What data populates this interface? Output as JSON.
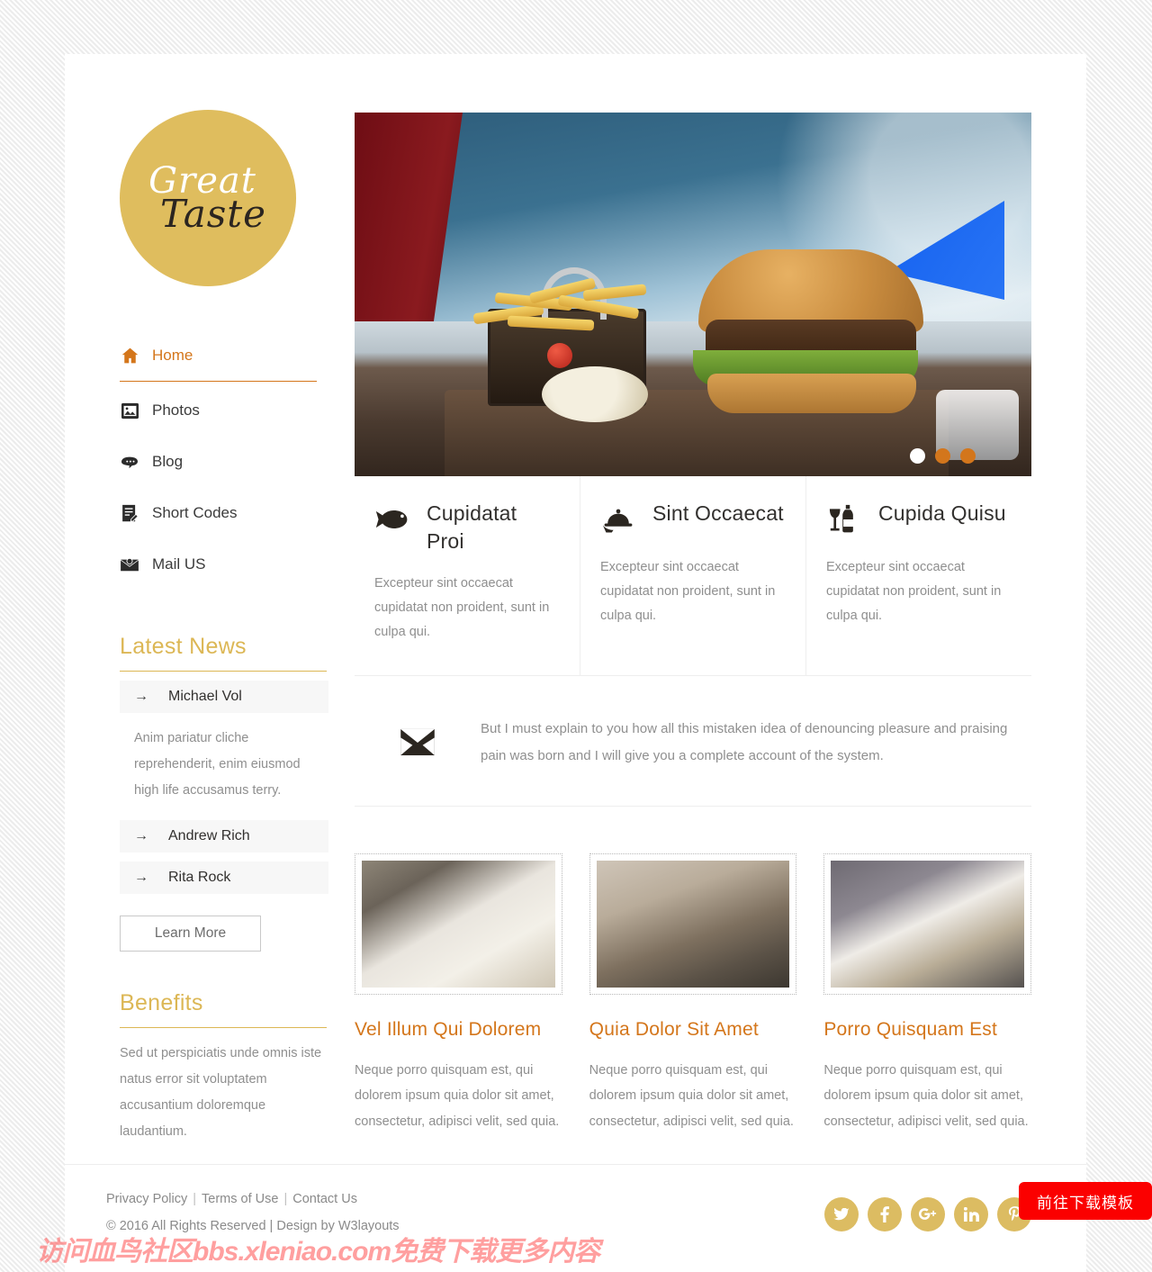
{
  "brand": {
    "line1": "Great",
    "line2": "Taste",
    "color": "#dfbd5e"
  },
  "nav": {
    "items": [
      {
        "label": "Home",
        "icon": "home-icon",
        "active": true
      },
      {
        "label": "Photos",
        "icon": "photo-icon",
        "active": false
      },
      {
        "label": "Blog",
        "icon": "blog-icon",
        "active": false
      },
      {
        "label": "Short Codes",
        "icon": "notepad-icon",
        "active": false
      },
      {
        "label": "Mail US",
        "icon": "mail-icon",
        "active": false
      }
    ],
    "active_color": "#d4761b"
  },
  "sidebar": {
    "news": {
      "heading": "Latest News",
      "items": [
        {
          "name": "Michael Vol",
          "body": "Anim pariatur cliche reprehenderit, enim eiusmod high life accusamus terry."
        },
        {
          "name": "Andrew Rich",
          "body": ""
        },
        {
          "name": "Rita Rock",
          "body": ""
        }
      ],
      "button": "Learn More"
    },
    "benefits": {
      "heading": "Benefits",
      "body": "Sed ut perspiciatis unde omnis iste natus error sit voluptatem accusantium doloremque laudantium."
    }
  },
  "hero": {
    "alt": "Burger with fries in a basket on a wooden board",
    "dots": [
      {
        "active": true
      },
      {
        "active": false
      },
      {
        "active": false
      }
    ],
    "dot_active_color": "#ffffff",
    "dot_color": "#d3761c"
  },
  "features": [
    {
      "icon": "fish-icon",
      "title": "Cupidatat Proi",
      "text": "Excepteur sint occaecat cupidatat non proident, sunt in culpa qui."
    },
    {
      "icon": "serving-dish-icon",
      "title": "Sint Occaecat",
      "text": "Excepteur sint occaecat cupidatat non proident, sunt in culpa qui."
    },
    {
      "icon": "wine-icon",
      "title": "Cupida Quisu",
      "text": "Excepteur sint occaecat cupidatat non proident, sunt in culpa qui."
    }
  ],
  "strip": {
    "icon": "envelope-icon",
    "text": "But I must explain to you how all this mistaken idea of denouncing pleasure and praising pain was born and I will give you a complete account of the system."
  },
  "cards": [
    {
      "title": "Vel Illum Qui Dolorem",
      "text": "Neque porro quisquam est, qui dolorem ipsum quia dolor sit amet, consectetur, adipisci velit, sed quia.",
      "image_alt": "Plated fish with broccoli"
    },
    {
      "title": "Quia Dolor Sit Amet",
      "text": "Neque porro quisquam est, qui dolorem ipsum quia dolor sit amet, consectetur, adipisci velit, sed quia.",
      "image_alt": "Pan of risotto with beer glass"
    },
    {
      "title": "Porro Quisquam Est",
      "text": "Neque porro quisquam est, qui dolorem ipsum quia dolor sit amet, consectetur, adipisci velit, sed quia.",
      "image_alt": "Curry with rice and cashews"
    }
  ],
  "footer": {
    "links": [
      "Privacy Policy",
      "Terms of Use",
      "Contact Us"
    ],
    "separator": "|",
    "copyright": "© 2016 All Rights Reserved | Design by W3layouts",
    "socials": [
      {
        "name": "twitter-icon",
        "glyph": "🐦"
      },
      {
        "name": "facebook-icon",
        "glyph": "f"
      },
      {
        "name": "google-plus-icon",
        "glyph": "g+"
      },
      {
        "name": "linkedin-icon",
        "glyph": "in"
      },
      {
        "name": "pinterest-icon",
        "glyph": "р"
      }
    ],
    "social_color": "#dcbc62"
  },
  "overlay": {
    "download_button": "前往下载模板",
    "download_color": "#fb0000",
    "watermark": "访问血鸟社区bbs.xleniao.com免费下载更多内容"
  }
}
